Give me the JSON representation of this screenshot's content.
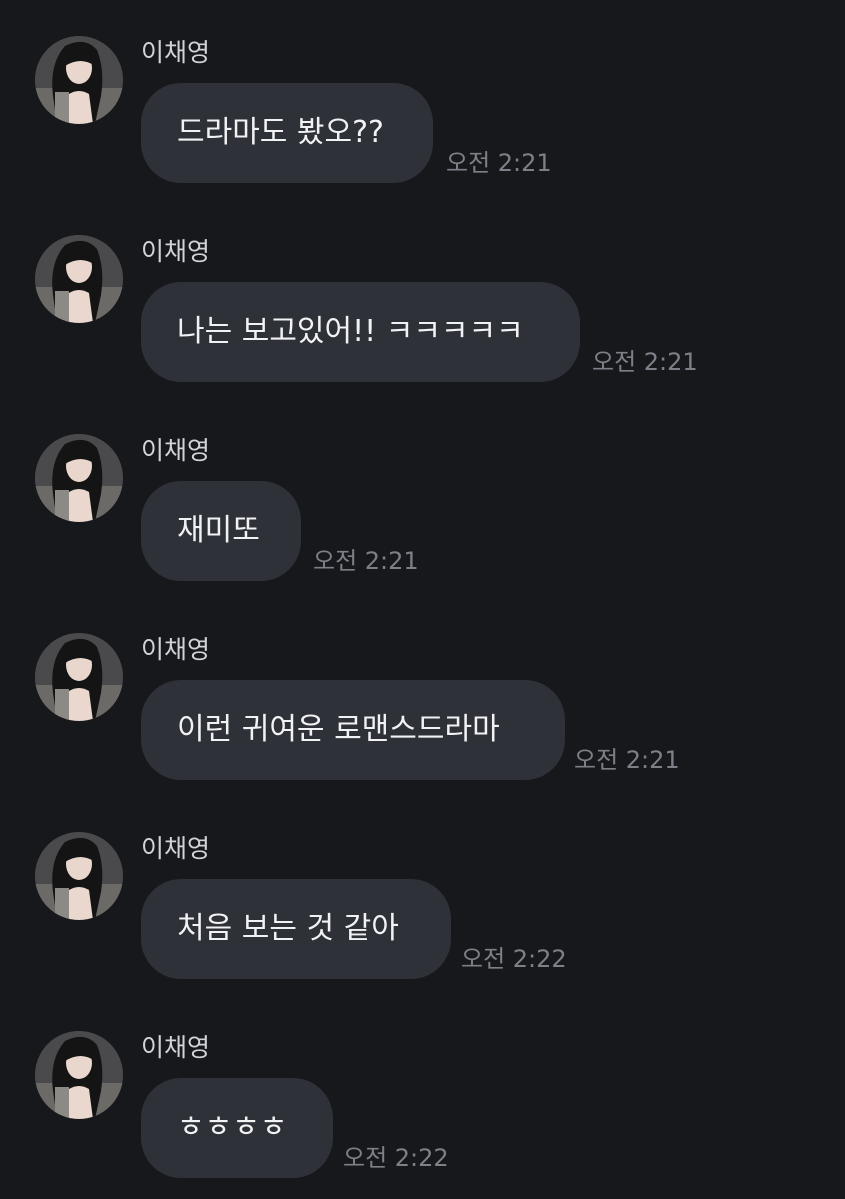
{
  "colors": {
    "background": "#17181c",
    "bubble": "#2e3138",
    "message_text": "#f1f2f4",
    "sender_text": "#d2d3d7",
    "time_text": "#7d8088"
  },
  "messages": [
    {
      "sender": "이채영",
      "avatar": "profile-photo",
      "text": "드라마도 봤오??",
      "time": "오전 2:21"
    },
    {
      "sender": "이채영",
      "avatar": "profile-photo",
      "text": "나는 보고있어!! ㅋㅋㅋㅋㅋ",
      "time": "오전 2:21"
    },
    {
      "sender": "이채영",
      "avatar": "profile-photo",
      "text": "재미또",
      "time": "오전 2:21"
    },
    {
      "sender": "이채영",
      "avatar": "profile-photo",
      "text": "이런 귀여운 로맨스드라마",
      "time": "오전 2:21"
    },
    {
      "sender": "이채영",
      "avatar": "profile-photo",
      "text": "처음 보는 것 같아",
      "time": "오전 2:22"
    },
    {
      "sender": "이채영",
      "avatar": "profile-photo",
      "text": "ㅎㅎㅎㅎ",
      "time": "오전 2:22"
    }
  ]
}
